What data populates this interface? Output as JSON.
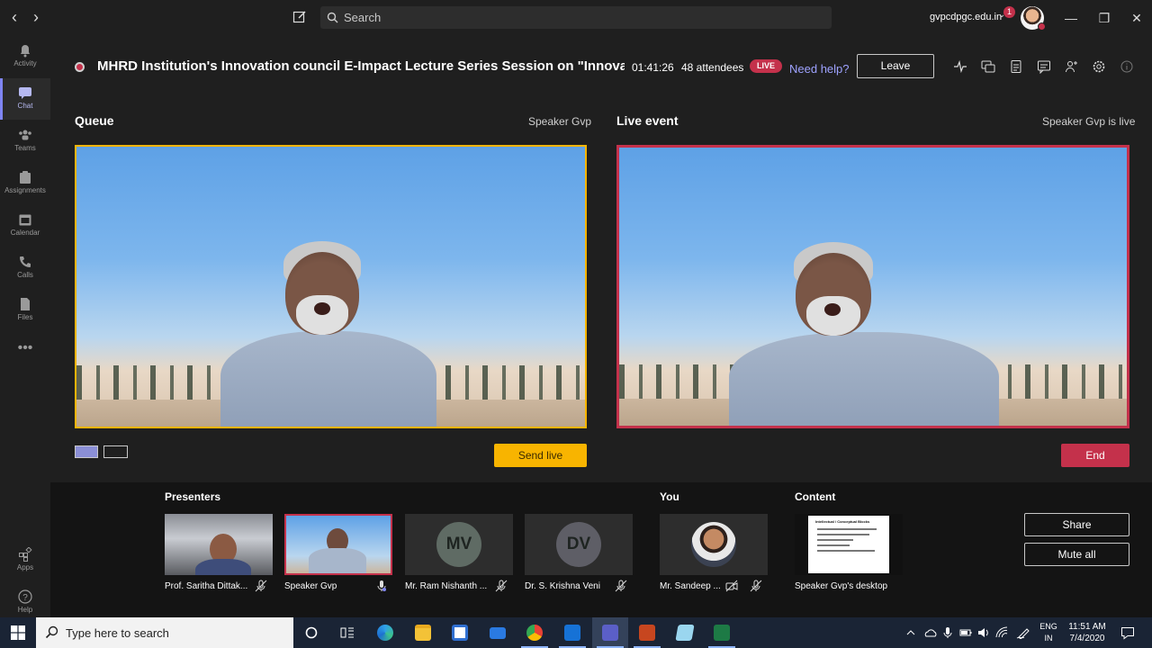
{
  "app": {
    "search_placeholder": "Search",
    "tenant": "gvpcdpgc.edu.in",
    "notification_count": "1"
  },
  "rail": [
    {
      "label": "Activity",
      "icon": "bell-icon"
    },
    {
      "label": "Chat",
      "icon": "chat-icon"
    },
    {
      "label": "Teams",
      "icon": "teams-icon"
    },
    {
      "label": "Assignments",
      "icon": "assignments-icon"
    },
    {
      "label": "Calendar",
      "icon": "calendar-icon"
    },
    {
      "label": "Calls",
      "icon": "phone-icon"
    },
    {
      "label": "Files",
      "icon": "file-icon"
    },
    {
      "label": "Apps",
      "icon": "apps-icon"
    },
    {
      "label": "Help",
      "icon": "help-icon"
    }
  ],
  "meeting": {
    "title": "MHRD Institution's Innovation council E-Impact Lecture Series Session on \"Innovation ...",
    "timer": "01:41:26",
    "attendees": "48 attendees",
    "live_badge": "LIVE",
    "need_help": "Need help?",
    "leave": "Leave"
  },
  "queue": {
    "title": "Queue",
    "source": "Speaker Gvp",
    "send_live": "Send live"
  },
  "live_event": {
    "title": "Live event",
    "status": "Speaker Gvp is live",
    "end": "End"
  },
  "strip": {
    "presenters_title": "Presenters",
    "you_title": "You",
    "content_title": "Content",
    "presenters": [
      {
        "name": "Prof. Saritha Dittak...",
        "mic": "mic-off"
      },
      {
        "name": "Speaker Gvp",
        "mic": "mic-on"
      },
      {
        "name": "Mr. Ram Nishanth ...",
        "initials": "MV",
        "mic": "mic-off"
      },
      {
        "name": "Dr. S. Krishna Veni",
        "initials": "DV",
        "mic": "mic-off"
      }
    ],
    "you": {
      "name": "Mr. Sandeep ..."
    },
    "content": {
      "name": "Speaker Gvp's desktop",
      "slide_heading": "Intellectual / Conceptual Blocks"
    },
    "share": "Share",
    "mute_all": "Mute all"
  },
  "taskbar": {
    "search_placeholder": "Type here to search",
    "lang_1": "ENG",
    "lang_2": "IN",
    "time": "11:51 AM",
    "date": "7/4/2020"
  },
  "colors": {
    "accent": "#7f85f5",
    "live_red": "#c4314b",
    "queue_yellow": "#f8b400"
  }
}
